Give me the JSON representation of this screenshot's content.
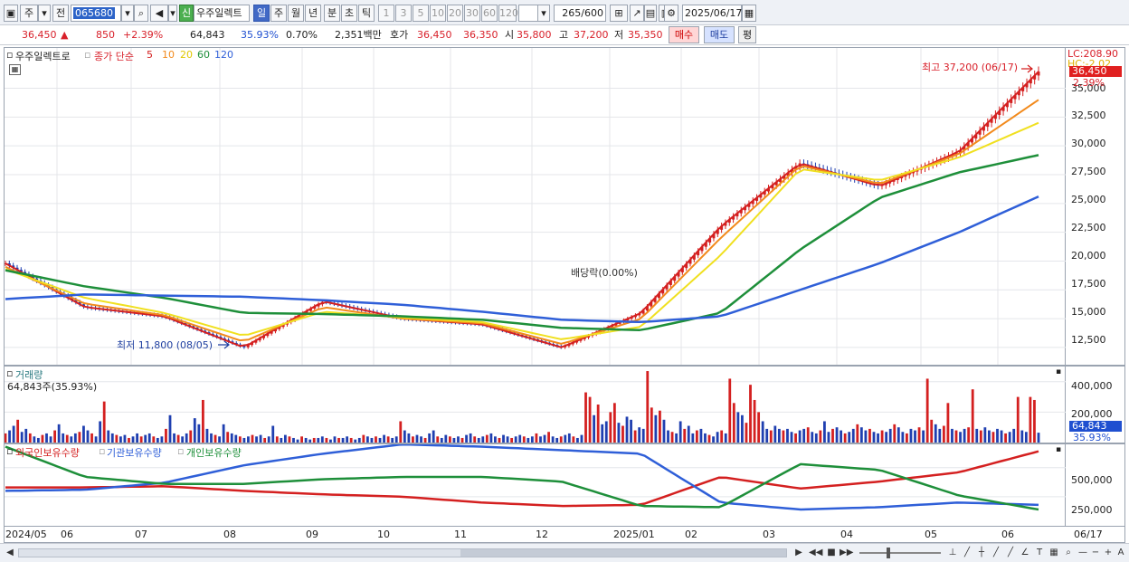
{
  "toolbar": {
    "market": "주",
    "prev": "전",
    "code": "065680",
    "new_badge": "신",
    "stock_name": "우주일렉트",
    "periods": [
      "일",
      "주",
      "월",
      "년",
      "분",
      "초",
      "틱"
    ],
    "selected_period": "일",
    "intervals": [
      "1",
      "3",
      "5",
      "10",
      "20",
      "30",
      "60",
      "120"
    ],
    "count": "265",
    "count_max": "/600",
    "date": "2025/06/17"
  },
  "quote": {
    "price": "36,450",
    "arrow": "▲",
    "change": "850",
    "change_pct": "+2.39%",
    "volume": "64,843",
    "volume_ratio": "35.93%",
    "turnover": "0.70%",
    "amount": "2,351백만",
    "hoga_label": "호가",
    "ask": "36,450",
    "bid": "36,350",
    "open_label": "시",
    "open": "35,800",
    "high_label": "고",
    "high": "37,200",
    "low_label": "저",
    "low": "35,350",
    "buy_label": "매수",
    "sell_label": "매도",
    "eval_label": "평"
  },
  "price_panel": {
    "stock_label": "우주일렉트로",
    "price_series_label": "종가 단순",
    "ma_labels": [
      "5",
      "10",
      "20",
      "60",
      "120"
    ],
    "ma_colors": [
      "#d42020",
      "#f28a1c",
      "#f0e020",
      "#1e8f3a",
      "#2f5fd8"
    ],
    "axis_ticks": [
      "35,000",
      "32,500",
      "30,000",
      "27,500",
      "25,000",
      "22,500",
      "20,000",
      "17,500",
      "15,000",
      "12,500"
    ],
    "lc_label": "LC:208.90",
    "hc_label": "HC:-2.02",
    "current_price_tag": "36,450",
    "current_pct_tag": "2.39%",
    "high_annotation": "최고 37,200 (06/17)",
    "low_annotation": "최저 11,800 (08/05)",
    "dividend_annotation": "배당락(0.00%)"
  },
  "volume_panel": {
    "title": "거래량",
    "current": "64,843주(35.93%)",
    "axis_ticks": [
      "400,000",
      "200,000"
    ],
    "volume_tag": "64,843",
    "volume_pct_tag": "35.93%"
  },
  "holdings_panel": {
    "legend": [
      "외국인보유수량",
      "기관보유수량",
      "개인보유수량"
    ],
    "legend_colors": [
      "#d42020",
      "#2f5fd8",
      "#1e8f3a"
    ],
    "axis_ticks": [
      "500,000",
      "250,000"
    ]
  },
  "x_axis": {
    "labels": [
      "2024/05",
      "06",
      "07",
      "08",
      "09",
      "10",
      "11",
      "12",
      "2025/01",
      "02",
      "03",
      "04",
      "05",
      "06"
    ],
    "end_label": "06/17"
  },
  "chart_data": [
    {
      "type": "line",
      "title": "",
      "x": [
        "2024/05",
        "06",
        "07",
        "08",
        "09",
        "10",
        "11",
        "12",
        "2025/01",
        "02",
        "03",
        "04",
        "05",
        "06/17"
      ],
      "series": [
        {
          "name": "5",
          "values": [
            19800,
            16000,
            15200,
            12500,
            16500,
            15000,
            14500,
            12500,
            15500,
            23000,
            28500,
            26500,
            29500,
            36450
          ]
        },
        {
          "name": "10",
          "values": [
            19500,
            16300,
            15300,
            13000,
            16000,
            15000,
            14600,
            12800,
            15000,
            22000,
            28300,
            26700,
            29300,
            34000
          ]
        },
        {
          "name": "20",
          "values": [
            19300,
            16800,
            15500,
            13500,
            15600,
            15100,
            14700,
            13200,
            14300,
            20500,
            28000,
            27000,
            29000,
            32000
          ]
        },
        {
          "name": "60",
          "values": [
            19200,
            17800,
            16800,
            15500,
            15400,
            15200,
            14900,
            14200,
            14000,
            15500,
            21000,
            25500,
            27700,
            29200
          ]
        },
        {
          "name": "120",
          "values": [
            16700,
            17100,
            17000,
            16900,
            16600,
            16200,
            15600,
            14900,
            14700,
            15200,
            17500,
            19800,
            22500,
            25600
          ]
        }
      ],
      "ylim": [
        11000,
        38500
      ]
    },
    {
      "type": "bar",
      "title": "거래량",
      "ylim": [
        0,
        500000
      ],
      "values": [
        60000,
        80000,
        110000,
        150000,
        70000,
        90000,
        60000,
        40000,
        30000,
        50000,
        60000,
        40000,
        80000,
        120000,
        60000,
        50000,
        40000,
        60000,
        70000,
        110000,
        80000,
        60000,
        40000,
        140000,
        270000,
        80000,
        60000,
        50000,
        40000,
        50000,
        30000,
        40000,
        60000,
        40000,
        50000,
        60000,
        40000,
        30000,
        40000,
        90000,
        180000,
        60000,
        50000,
        40000,
        60000,
        80000,
        160000,
        120000,
        280000,
        90000,
        60000,
        50000,
        40000,
        120000,
        70000,
        60000,
        50000,
        40000,
        30000,
        40000,
        50000,
        40000,
        50000,
        30000,
        40000,
        110000,
        40000,
        30000,
        50000,
        40000,
        30000,
        20000,
        40000,
        30000,
        20000,
        30000,
        30000,
        40000,
        30000,
        20000,
        40000,
        30000,
        30000,
        40000,
        30000,
        20000,
        30000,
        50000,
        40000,
        30000,
        40000,
        30000,
        50000,
        40000,
        30000,
        40000,
        140000,
        80000,
        60000,
        40000,
        50000,
        40000,
        30000,
        60000,
        80000,
        40000,
        30000,
        50000,
        40000,
        30000,
        40000,
        30000,
        50000,
        60000,
        40000,
        30000,
        40000,
        50000,
        60000,
        40000,
        30000,
        50000,
        40000,
        30000,
        40000,
        50000,
        40000,
        30000,
        40000,
        60000,
        40000,
        50000,
        70000,
        40000,
        30000,
        40000,
        50000,
        60000,
        40000,
        30000,
        50000,
        330000,
        300000,
        180000,
        250000,
        120000,
        140000,
        200000,
        260000,
        130000,
        110000,
        170000,
        150000,
        80000,
        100000,
        90000,
        470000,
        230000,
        180000,
        210000,
        150000,
        80000,
        70000,
        60000,
        140000,
        90000,
        110000,
        60000,
        80000,
        90000,
        60000,
        50000,
        40000,
        70000,
        80000,
        60000,
        420000,
        260000,
        200000,
        180000,
        130000,
        380000,
        280000,
        200000,
        140000,
        90000,
        80000,
        110000,
        90000,
        80000,
        90000,
        70000,
        60000,
        80000,
        90000,
        100000,
        70000,
        60000,
        80000,
        140000,
        70000,
        90000,
        100000,
        80000,
        60000,
        70000,
        90000,
        120000,
        100000,
        80000,
        90000,
        70000,
        60000,
        80000,
        70000,
        90000,
        120000,
        100000,
        70000,
        60000,
        90000,
        80000,
        100000,
        80000,
        420000,
        150000,
        120000,
        90000,
        110000,
        260000,
        90000,
        80000,
        70000,
        90000,
        100000,
        350000,
        90000,
        80000,
        100000,
        80000,
        70000,
        90000,
        80000,
        60000,
        70000,
        90000,
        300000,
        80000,
        70000,
        300000,
        280000,
        64843
      ]
    },
    {
      "type": "line",
      "title": "보유수량",
      "x": [
        "2024/05",
        "06",
        "07",
        "08",
        "09",
        "10",
        "11",
        "12",
        "2025/01",
        "02",
        "03",
        "04",
        "05",
        "06/17"
      ],
      "series": [
        {
          "name": "외국인보유수량",
          "values": [
            330000,
            330000,
            340000,
            300000,
            270000,
            250000,
            200000,
            170000,
            180000,
            420000,
            320000,
            380000,
            460000,
            640000
          ]
        },
        {
          "name": "기관보유수량",
          "values": [
            300000,
            310000,
            370000,
            520000,
            620000,
            700000,
            680000,
            650000,
            620000,
            200000,
            140000,
            160000,
            200000,
            180000
          ]
        },
        {
          "name": "개인보유수량",
          "values": [
            680000,
            420000,
            360000,
            360000,
            400000,
            420000,
            420000,
            380000,
            170000,
            160000,
            530000,
            480000,
            260000,
            140000
          ]
        }
      ],
      "ylim": [
        0,
        700000
      ]
    }
  ]
}
